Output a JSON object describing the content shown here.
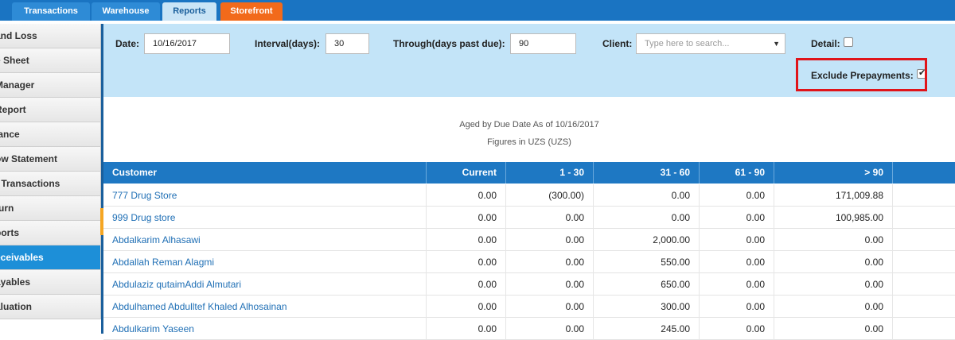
{
  "nav": {
    "tabs": [
      {
        "label": "Transactions"
      },
      {
        "label": "Warehouse"
      },
      {
        "label": "Reports"
      },
      {
        "label": "Storefront"
      }
    ]
  },
  "sidebar": {
    "items": [
      {
        "label": "and Loss"
      },
      {
        "label": "e Sheet"
      },
      {
        "label": "Manager"
      },
      {
        "label": " Report"
      },
      {
        "label": "lance"
      },
      {
        "label": "ow Statement"
      },
      {
        "label": "t Transactions"
      },
      {
        "label": "turn"
      },
      {
        "label": "ports"
      },
      {
        "label": "eceivables"
      },
      {
        "label": "ayables"
      },
      {
        "label": "aluation"
      }
    ]
  },
  "filters": {
    "date_label": "Date:",
    "date_value": "10/16/2017",
    "interval_label": "Interval(days):",
    "interval_value": "30",
    "through_label": "Through(days past due):",
    "through_value": "90",
    "client_label": "Client:",
    "client_placeholder": "Type here to search...",
    "detail_label": "Detail:",
    "exclude_label": "Exclude Prepayments:"
  },
  "report": {
    "title": "Aged by Due Date As of 10/16/2017",
    "subtitle": "Figures in UZS (UZS)"
  },
  "table": {
    "headers": [
      "Customer",
      "Current",
      "1 - 30",
      "31 - 60",
      "61 - 90",
      "> 90"
    ],
    "rows": [
      [
        "777 Drug Store",
        "0.00",
        "(300.00)",
        "0.00",
        "0.00",
        "171,009.88"
      ],
      [
        "999 Drug store",
        "0.00",
        "0.00",
        "0.00",
        "0.00",
        "100,985.00"
      ],
      [
        "Abdalkarim Alhasawi",
        "0.00",
        "0.00",
        "2,000.00",
        "0.00",
        "0.00"
      ],
      [
        "Abdallah Reman Alagmi",
        "0.00",
        "0.00",
        "550.00",
        "0.00",
        "0.00"
      ],
      [
        "Abdulaziz qutaimAddi Almutari",
        "0.00",
        "0.00",
        "650.00",
        "0.00",
        "0.00"
      ],
      [
        "Abdulhamed Abdulltef Khaled Alhosainan",
        "0.00",
        "0.00",
        "300.00",
        "0.00",
        "0.00"
      ],
      [
        "Abdulkarim Yaseen",
        "0.00",
        "0.00",
        "245.00",
        "0.00",
        "0.00"
      ]
    ]
  }
}
